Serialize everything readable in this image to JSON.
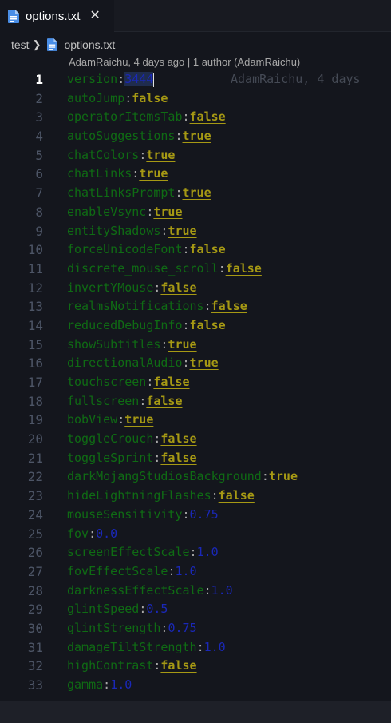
{
  "tab": {
    "label": "options.txt",
    "close": "✕"
  },
  "breadcrumb": {
    "folder": "test",
    "file": "options.txt"
  },
  "blame_header": "AdamRaichu, 4 days ago | 1 author (AdamRaichu)",
  "inline_blame": "AdamRaichu, 4 days",
  "colors": {
    "key": "#0f6b14",
    "bool": "#a69914",
    "number": "#1a28b8"
  },
  "lines": [
    {
      "n": "1",
      "key": "version",
      "val": "3444",
      "type": "ver"
    },
    {
      "n": "2",
      "key": "autoJump",
      "val": "false",
      "type": "bool"
    },
    {
      "n": "3",
      "key": "operatorItemsTab",
      "val": "false",
      "type": "bool"
    },
    {
      "n": "4",
      "key": "autoSuggestions",
      "val": "true",
      "type": "bool"
    },
    {
      "n": "5",
      "key": "chatColors",
      "val": "true",
      "type": "bool"
    },
    {
      "n": "6",
      "key": "chatLinks",
      "val": "true",
      "type": "bool"
    },
    {
      "n": "7",
      "key": "chatLinksPrompt",
      "val": "true",
      "type": "bool"
    },
    {
      "n": "8",
      "key": "enableVsync",
      "val": "true",
      "type": "bool"
    },
    {
      "n": "9",
      "key": "entityShadows",
      "val": "true",
      "type": "bool"
    },
    {
      "n": "10",
      "key": "forceUnicodeFont",
      "val": "false",
      "type": "bool"
    },
    {
      "n": "11",
      "key": "discrete_mouse_scroll",
      "val": "false",
      "type": "bool"
    },
    {
      "n": "12",
      "key": "invertYMouse",
      "val": "false",
      "type": "bool"
    },
    {
      "n": "13",
      "key": "realmsNotifications",
      "val": "false",
      "type": "bool"
    },
    {
      "n": "14",
      "key": "reducedDebugInfo",
      "val": "false",
      "type": "bool"
    },
    {
      "n": "15",
      "key": "showSubtitles",
      "val": "true",
      "type": "bool"
    },
    {
      "n": "16",
      "key": "directionalAudio",
      "val": "true",
      "type": "bool"
    },
    {
      "n": "17",
      "key": "touchscreen",
      "val": "false",
      "type": "bool"
    },
    {
      "n": "18",
      "key": "fullscreen",
      "val": "false",
      "type": "bool"
    },
    {
      "n": "19",
      "key": "bobView",
      "val": "true",
      "type": "bool"
    },
    {
      "n": "20",
      "key": "toggleCrouch",
      "val": "false",
      "type": "bool"
    },
    {
      "n": "21",
      "key": "toggleSprint",
      "val": "false",
      "type": "bool"
    },
    {
      "n": "22",
      "key": "darkMojangStudiosBackground",
      "val": "true",
      "type": "bool"
    },
    {
      "n": "23",
      "key": "hideLightningFlashes",
      "val": "false",
      "type": "bool"
    },
    {
      "n": "24",
      "key": "mouseSensitivity",
      "val": "0.75",
      "type": "num"
    },
    {
      "n": "25",
      "key": "fov",
      "val": "0.0",
      "type": "num"
    },
    {
      "n": "26",
      "key": "screenEffectScale",
      "val": "1.0",
      "type": "num"
    },
    {
      "n": "27",
      "key": "fovEffectScale",
      "val": "1.0",
      "type": "num"
    },
    {
      "n": "28",
      "key": "darknessEffectScale",
      "val": "1.0",
      "type": "num"
    },
    {
      "n": "29",
      "key": "glintSpeed",
      "val": "0.5",
      "type": "num"
    },
    {
      "n": "30",
      "key": "glintStrength",
      "val": "0.75",
      "type": "num"
    },
    {
      "n": "31",
      "key": "damageTiltStrength",
      "val": "1.0",
      "type": "num"
    },
    {
      "n": "32",
      "key": "highContrast",
      "val": "false",
      "type": "bool"
    },
    {
      "n": "33",
      "key": "gamma",
      "val": "1.0",
      "type": "num"
    }
  ]
}
